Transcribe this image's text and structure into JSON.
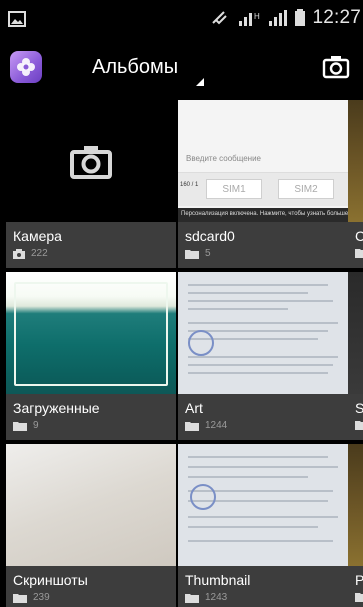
{
  "statusbar": {
    "time": "12:27"
  },
  "actionbar": {
    "title": "Альбомы"
  },
  "albums": [
    {
      "name": "Камера",
      "count": "222",
      "type": "camera"
    },
    {
      "name": "sdcard0",
      "count": "5",
      "type": "folder"
    },
    {
      "name": "С",
      "count": "",
      "type": "folder"
    },
    {
      "name": "Загруженные",
      "count": "9",
      "type": "folder"
    },
    {
      "name": "Art",
      "count": "1244",
      "type": "folder"
    },
    {
      "name": "S",
      "count": "",
      "type": "folder"
    },
    {
      "name": "Скриншоты",
      "count": "239",
      "type": "folder"
    },
    {
      "name": "Thumbnail",
      "count": "1243",
      "type": "folder"
    },
    {
      "name": "P",
      "count": "",
      "type": "folder"
    }
  ],
  "sd_preview": {
    "input_placeholder": "Введите сообщение",
    "sim1": "SIM1",
    "sim2": "SIM2",
    "counter": "160 / 1",
    "note": "Персонализация включена. Нажмите, чтобы узнать больше."
  },
  "icons": [
    "gallery-app-icon",
    "camera-icon",
    "folder-icon",
    "signal-icon",
    "battery-icon",
    "mute-icon"
  ]
}
